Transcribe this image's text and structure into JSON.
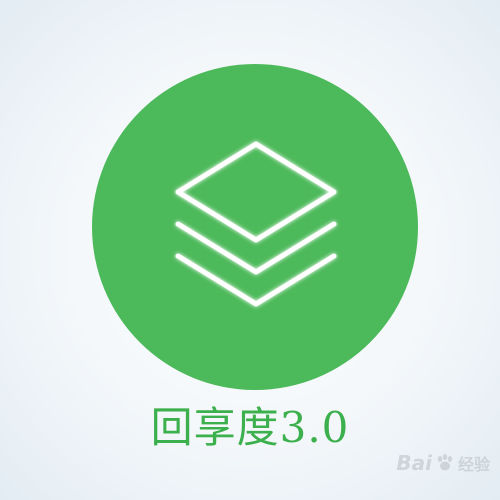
{
  "app": {
    "title": "回享度3.0"
  },
  "icon": {
    "name": "layers-icon",
    "circle_color": "#4cb95a",
    "stroke_color": "#ffffff"
  },
  "watermark": {
    "brand_left": "Bai",
    "paw_icon": "paw-icon",
    "brand_right": "经验"
  }
}
